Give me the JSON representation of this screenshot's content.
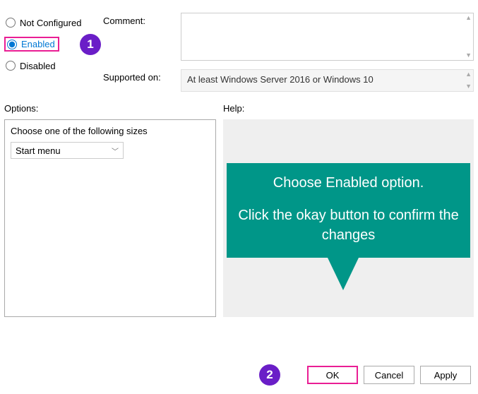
{
  "radios": {
    "not_configured": "Not Configured",
    "enabled": "Enabled",
    "disabled": "Disabled"
  },
  "fields": {
    "comment_label": "Comment:",
    "comment_value": "",
    "supported_label": "Supported on:",
    "supported_value": "At least Windows Server 2016 or Windows 10"
  },
  "section_labels": {
    "options": "Options:",
    "help": "Help:"
  },
  "options": {
    "choose_text": "Choose one of the following sizes",
    "dropdown_value": "Start menu"
  },
  "callout": {
    "line1": "Choose Enabled option.",
    "line2": "Click the okay button to confirm the changes"
  },
  "buttons": {
    "ok": "OK",
    "cancel": "Cancel",
    "apply": "Apply"
  },
  "badges": {
    "one": "1",
    "two": "2"
  }
}
